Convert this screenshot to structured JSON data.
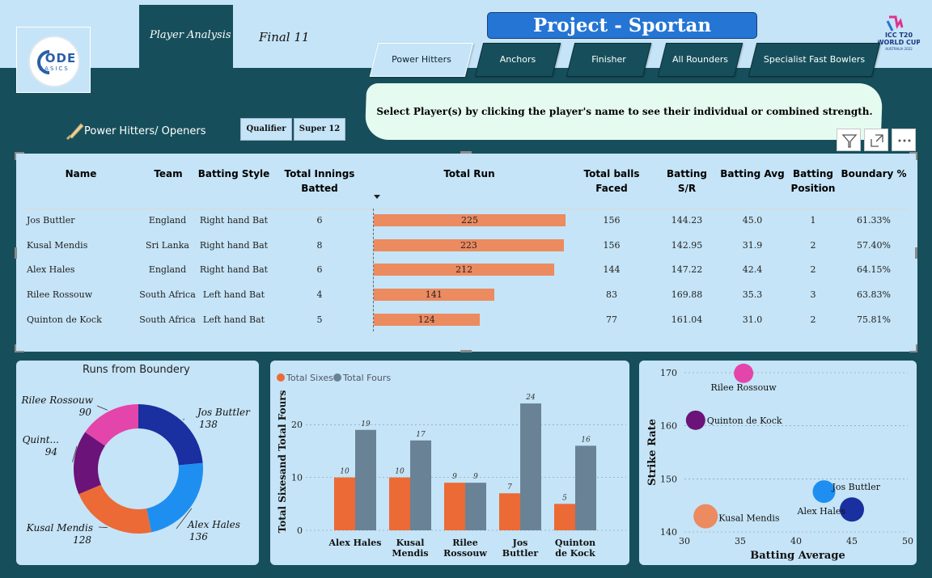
{
  "header": {
    "page_tabs": [
      {
        "label": "Player Analysis",
        "active": true
      },
      {
        "label": "Final 11",
        "active": false
      }
    ],
    "title": "Project - Sportan",
    "logo": {
      "line1": "ODE",
      "line2": "BASICS"
    },
    "event_logo": {
      "icon": "icc-t20-world-cup-logo",
      "line1": "ICC T20",
      "line2": "WORLD CUP",
      "line3": "AUSTRALIA 2022"
    },
    "category_tabs": [
      {
        "label": "Power Hitters",
        "active": true
      },
      {
        "label": "Anchors",
        "active": false
      },
      {
        "label": "Finisher",
        "active": false
      },
      {
        "label": "All Rounders",
        "active": false
      },
      {
        "label": "Specialist Fast Bowlers",
        "active": false
      }
    ],
    "info_text": "Select Player(s) by clicking the player's name to see their individual or combined strength."
  },
  "section": {
    "title": "Power Hitters/ Openers",
    "icon": "cricket-bat-icon",
    "phase_buttons": [
      "Qualifier",
      "Super 12"
    ]
  },
  "toolbar": [
    "filter-icon",
    "focus-mode-icon",
    "more-options-icon"
  ],
  "table": {
    "columns": [
      "Name",
      "Team",
      "Batting Style",
      "Total Innings Batted",
      "Total Run",
      "Total balls Faced",
      "Batting S/R",
      "Batting Avg",
      "Batting Position",
      "Boundary %"
    ],
    "sort_indicator": "descending",
    "rows": [
      {
        "name": "Jos Buttler",
        "team": "England",
        "style": "Right hand Bat",
        "innings": "6",
        "runs": 225,
        "balls": "156",
        "sr": "144.23",
        "avg": "45.0",
        "pos": "1",
        "boundary": "61.33%"
      },
      {
        "name": "Kusal Mendis",
        "team": "Sri Lanka",
        "style": "Right hand Bat",
        "innings": "8",
        "runs": 223,
        "balls": "156",
        "sr": "142.95",
        "avg": "31.9",
        "pos": "2",
        "boundary": "57.40%"
      },
      {
        "name": "Alex Hales",
        "team": "England",
        "style": "Right hand Bat",
        "innings": "6",
        "runs": 212,
        "balls": "144",
        "sr": "147.22",
        "avg": "42.4",
        "pos": "2",
        "boundary": "64.15%"
      },
      {
        "name": "Rilee Rossouw",
        "team": "South Africa",
        "style": "Left hand Bat",
        "innings": "4",
        "runs": 141,
        "balls": "83",
        "sr": "169.88",
        "avg": "35.3",
        "pos": "3",
        "boundary": "63.83%"
      },
      {
        "name": "Quinton de Kock",
        "team": "South Africa",
        "style": "Left hand Bat",
        "innings": "5",
        "runs": 124,
        "balls": "77",
        "sr": "161.04",
        "avg": "31.0",
        "pos": "2",
        "boundary": "75.81%"
      }
    ],
    "run_bar_color": "#ec8a60"
  },
  "chart_data": [
    {
      "type": "pie",
      "title": "Runs from Boundery",
      "slices": [
        {
          "label": "Jos Buttler",
          "value": 138,
          "color": "#1a2fa0"
        },
        {
          "label": "Alex Hales",
          "value": 136,
          "color": "#1e8ff0"
        },
        {
          "label": "Kusal Mendis",
          "value": 128,
          "color": "#ec6a35"
        },
        {
          "label": "Quint...",
          "value": 94,
          "color": "#6b1378"
        },
        {
          "label": "Rilee Rossouw",
          "value": 90,
          "color": "#e445aa"
        }
      ]
    },
    {
      "type": "bar",
      "ylabel": "Total Sixesand Total Fours",
      "categories": [
        "Alex Hales",
        "Kusal Mendis",
        "Rilee Rossouw",
        "Jos Buttler",
        "Quinton de Kock"
      ],
      "series": [
        {
          "name": "Total Sixes",
          "values": [
            10,
            10,
            9,
            7,
            5
          ],
          "color": "#ec6a35"
        },
        {
          "name": "Total Fours",
          "values": [
            19,
            17,
            9,
            24,
            16
          ],
          "color": "#6a8296"
        }
      ],
      "ylim": [
        0,
        26
      ],
      "yticks": [
        0,
        10,
        20
      ],
      "legend_position": "top-left"
    },
    {
      "type": "scatter",
      "xlabel": "Batting Average",
      "ylabel": "Strike Rate",
      "xlim": [
        30,
        50
      ],
      "ylim": [
        140,
        170
      ],
      "xticks": [
        30,
        35,
        40,
        45,
        50
      ],
      "yticks": [
        140,
        150,
        160,
        170
      ],
      "points": [
        {
          "label": "Jos Buttler",
          "x": 42.5,
          "y": 147.6,
          "color": "#1e8ff0"
        },
        {
          "label": "Kusal Mendis",
          "x": 31.9,
          "y": 142.95,
          "color": "#ec8a60"
        },
        {
          "label": "Alex Hales",
          "x": 45.0,
          "y": 144.23,
          "color": "#1a2fa0"
        },
        {
          "label": "Rilee Rossouw",
          "x": 35.3,
          "y": 169.88,
          "color": "#e445aa"
        },
        {
          "label": "Quinton de Kock",
          "x": 31.0,
          "y": 161.04,
          "color": "#6b1378"
        }
      ]
    }
  ]
}
